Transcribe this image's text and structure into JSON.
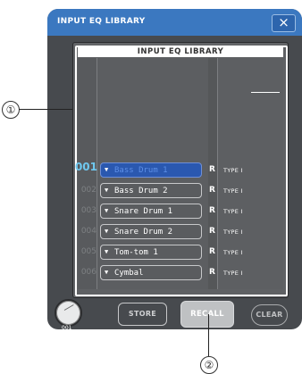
{
  "dialog": {
    "title": "INPUT EQ LIBRARY",
    "close_glyph": "×"
  },
  "library": {
    "header": "INPUT EQ LIBRARY",
    "rows": [
      {
        "num": "001",
        "name": "Bass Drum 1",
        "r": "R",
        "type": "TYPE I",
        "selected": true
      },
      {
        "num": "002",
        "name": "Bass Drum 2",
        "r": "R",
        "type": "TYPE I",
        "selected": false
      },
      {
        "num": "003",
        "name": "Snare Drum 1",
        "r": "R",
        "type": "TYPE I",
        "selected": false
      },
      {
        "num": "004",
        "name": "Snare Drum 2",
        "r": "R",
        "type": "TYPE I",
        "selected": false
      },
      {
        "num": "005",
        "name": "Tom-tom 1",
        "r": "R",
        "type": "TYPE I",
        "selected": false
      },
      {
        "num": "006",
        "name": "Cymbal",
        "r": "R",
        "type": "TYPE I",
        "selected": false
      }
    ]
  },
  "controls": {
    "knob_value": "001",
    "store_label": "STORE",
    "recall_label": "RECALL",
    "clear_label": "CLEAR"
  },
  "callouts": {
    "one": "①",
    "two": "②"
  },
  "colors": {
    "title_bar": "#3b78c0",
    "selected_number": "#6fc8ef",
    "selected_row": "#2a58b0"
  },
  "icons": {
    "close": "close-icon",
    "dropdown": "dropdown-arrow-icon",
    "knob": "rotary-knob-icon"
  }
}
